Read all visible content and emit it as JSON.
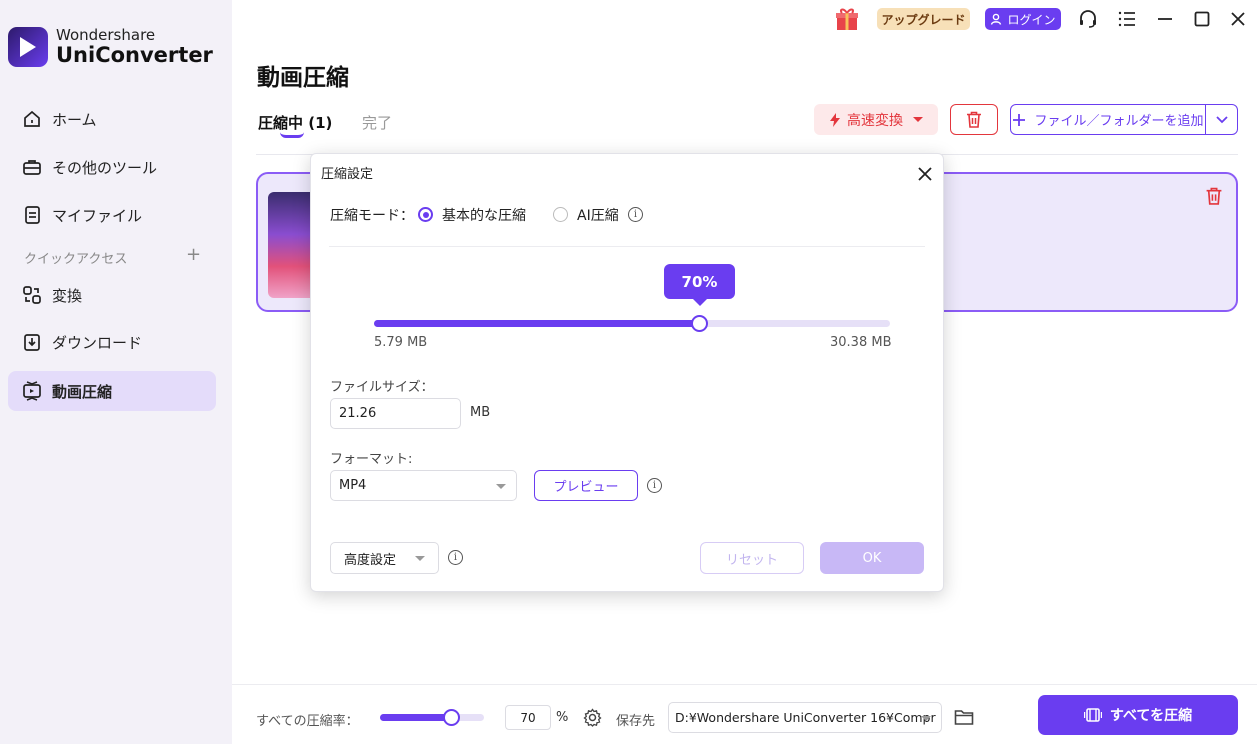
{
  "app": {
    "brand": "Wondershare",
    "product": "UniConverter",
    "upgrade_label": "アップグレード",
    "login_label": "ログイン"
  },
  "sidebar": {
    "items": [
      {
        "label": "ホーム",
        "icon": "home-icon"
      },
      {
        "label": "その他のツール",
        "icon": "toolbox-icon"
      },
      {
        "label": "マイファイル",
        "icon": "file-icon"
      },
      {
        "label": "変換",
        "icon": "convert-icon"
      },
      {
        "label": "ダウンロード",
        "icon": "download-icon"
      },
      {
        "label": "動画圧縮",
        "icon": "compress-icon",
        "active": true
      }
    ],
    "quick_access_label": "クイックアクセス"
  },
  "main": {
    "title": "動画圧縮",
    "tabs": [
      {
        "label": "圧縮中 (1)",
        "active": true
      },
      {
        "label": "完了",
        "active": false
      }
    ],
    "fast_convert_label": "高速変換",
    "add_files_label": "ファイル／フォルダーを追加"
  },
  "modal": {
    "title": "圧縮設定",
    "mode_label": "圧縮モード：",
    "mode_basic": "基本的な圧縮",
    "mode_ai": "AI圧縮",
    "selected_mode": "basic",
    "percent": 70,
    "percent_label": "70%",
    "size_min": "5.79 MB",
    "size_max": "30.38 MB",
    "file_size_label": "ファイルサイズ：",
    "file_size_value": "21.26",
    "file_size_unit": "MB",
    "format_label": "フォーマット:",
    "format_value": "MP4",
    "preview_label": "プレビュー",
    "advanced_label": "高度設定",
    "reset_label": "リセット",
    "ok_label": "OK"
  },
  "bottom": {
    "rate_label": "すべての圧縮率：",
    "rate_value": "70",
    "rate_percent": 70,
    "percent_sign": "%",
    "save_label": "保存先",
    "save_path": "D:¥Wondershare UniConverter 16¥Compr",
    "compress_all_label": "すべてを圧縮"
  },
  "colors": {
    "accent": "#6a3df0",
    "danger": "#e3363d",
    "sidebar_bg": "#f3f1f8"
  }
}
